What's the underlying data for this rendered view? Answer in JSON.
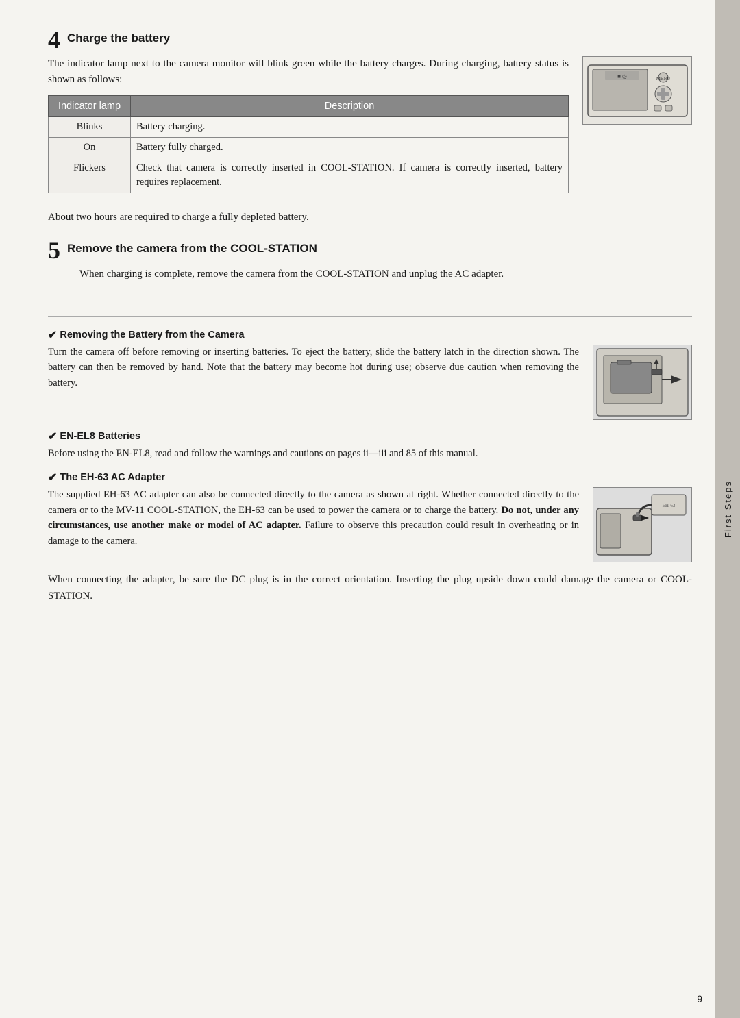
{
  "page": {
    "number": "9",
    "sidebar_label": "First Steps"
  },
  "step4": {
    "number": "4",
    "title": "Charge the battery",
    "body_text": "The indicator lamp next to the camera monitor will blink green while the battery charges.  During charging, battery status is shown as follows:",
    "about_text": "About two hours are required to charge a fully depleted battery."
  },
  "table": {
    "col1": "Indicator lamp",
    "col2": "Description",
    "rows": [
      {
        "lamp": "Blinks",
        "desc": "Battery charging."
      },
      {
        "lamp": "On",
        "desc": "Battery fully charged."
      },
      {
        "lamp": "Flickers",
        "desc": "Check that camera is correctly inserted in COOL-STATION.  If camera is correctly inserted, battery requires replacement."
      }
    ]
  },
  "step5": {
    "number": "5",
    "title": "Remove the camera from the COOL-STATION",
    "body_text": "When charging is complete, remove the camera from the COOL-STATION and unplug the AC adapter."
  },
  "note1": {
    "title": "Removing the Battery from the Camera",
    "text_before": "Turn the camera off",
    "text_after": "  before removing or inserting batteries. To eject the battery, slide the battery latch in the direction shown.  The battery can then be removed by hand.  Note that the battery may become hot during use; observe due caution when removing the battery."
  },
  "note2": {
    "title": "EN-EL8 Batteries",
    "text": "Before using the EN-EL8, read and follow the warnings and cautions on pages ii—iii and 85 of this manual."
  },
  "note3": {
    "title": "The EH-63 AC Adapter",
    "text_normal": "The supplied EH-63 AC adapter can also be connected directly to the camera as shown at right.  Whether connected directly to the camera or to the MV-11 COOL-STATION, the EH-63 can be used to power the camera or to charge the battery. ",
    "text_bold": "Do not, under any circumstances, use another make or model of AC adapter.",
    "text_end": "   Failure to observe this precaution could result in overheating or in damage to the camera."
  },
  "bottom_text": "When connecting the adapter, be sure the DC plug is in the correct orientation. Inserting the plug upside down could damage the camera or COOL-STATION."
}
